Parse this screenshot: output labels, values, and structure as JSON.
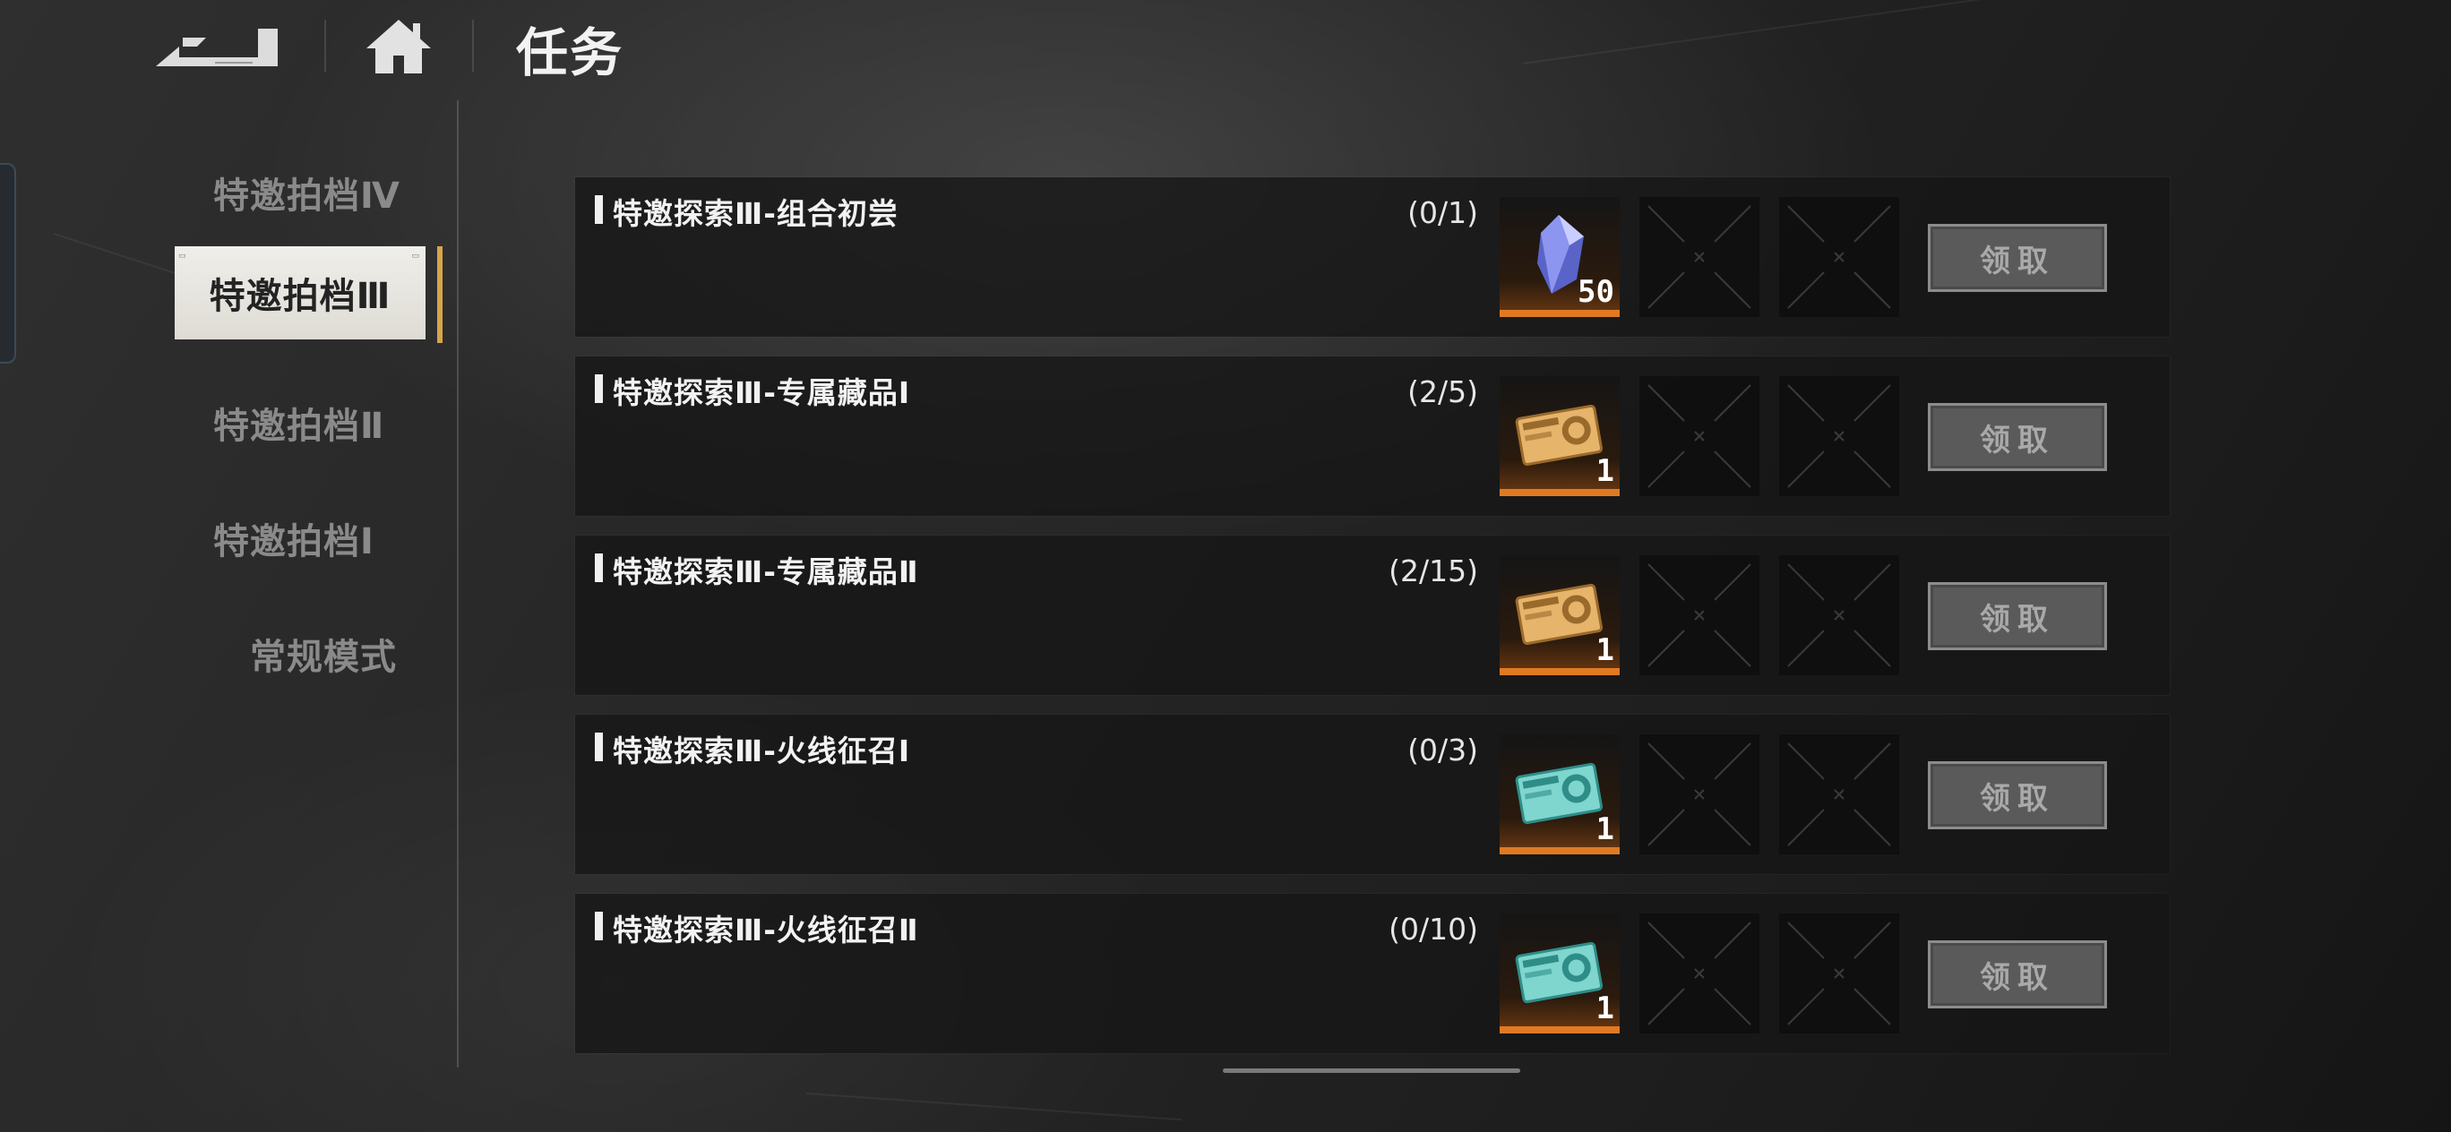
{
  "header": {
    "title": "任务",
    "back_icon": "back-arrow-icon",
    "home_icon": "home-icon"
  },
  "sidebar": {
    "items": [
      {
        "label": "特邀拍档Ⅳ",
        "active": false
      },
      {
        "label": "特邀拍档Ⅲ",
        "active": true
      },
      {
        "label": "特邀拍档Ⅱ",
        "active": false
      },
      {
        "label": "特邀拍档Ⅰ",
        "active": false
      },
      {
        "label": "常规模式",
        "active": false
      }
    ]
  },
  "tasks": [
    {
      "title": "特邀探索Ⅲ-组合初尝",
      "progress": "(0/1)",
      "reward": {
        "icon": "blue-crystal-icon",
        "quantity": "50"
      },
      "claim_label": "领取"
    },
    {
      "title": "特邀探索Ⅲ-专属藏品Ⅰ",
      "progress": "(2/5)",
      "reward": {
        "icon": "gold-ticket-icon",
        "quantity": "1"
      },
      "claim_label": "领取"
    },
    {
      "title": "特邀探索Ⅲ-专属藏品Ⅱ",
      "progress": "(2/15)",
      "reward": {
        "icon": "gold-ticket-icon",
        "quantity": "1"
      },
      "claim_label": "领取"
    },
    {
      "title": "特邀探索Ⅲ-火线征召Ⅰ",
      "progress": "(0/3)",
      "reward": {
        "icon": "teal-ticket-icon",
        "quantity": "1"
      },
      "claim_label": "领取"
    },
    {
      "title": "特邀探索Ⅲ-火线征召Ⅱ",
      "progress": "(0/10)",
      "reward": {
        "icon": "teal-ticket-icon",
        "quantity": "1"
      },
      "claim_label": "领取"
    }
  ],
  "colors": {
    "accent": "#d6a64a",
    "reward_bar": "#e07a22",
    "claim_button_bg": "#5a5a5a"
  }
}
